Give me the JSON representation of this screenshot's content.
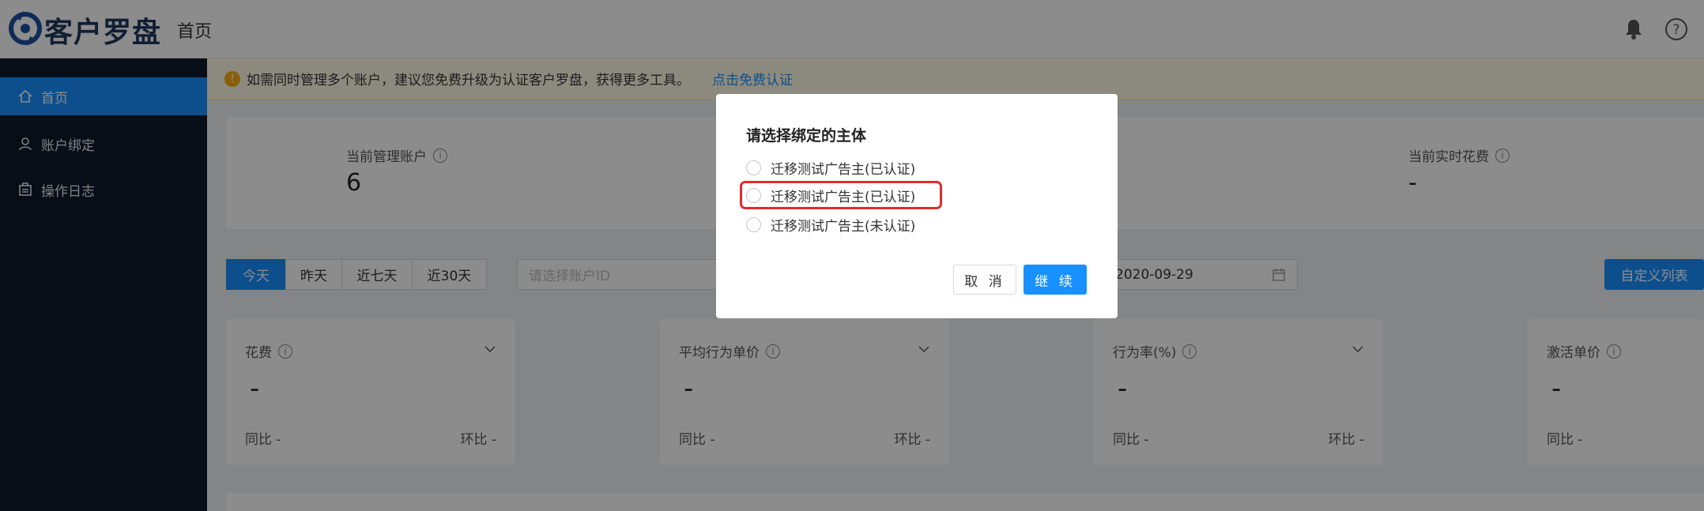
{
  "header": {
    "brand": "客户罗盘",
    "nav_title": "首页",
    "icons": [
      "compass-logo-icon",
      "bell-icon",
      "help-icon"
    ]
  },
  "sidebar": {
    "items": [
      {
        "label": "首页",
        "icon": "home-icon",
        "active": true
      },
      {
        "label": "账户绑定",
        "icon": "user-icon",
        "active": false
      },
      {
        "label": "操作日志",
        "icon": "log-icon",
        "active": false
      }
    ]
  },
  "notice": {
    "text": "如需同时管理多个账户，建议您免费升级为认证客户罗盘，获得更多工具。",
    "link": "点击免费认证"
  },
  "stats": {
    "managed_accounts_label": "当前管理账户",
    "managed_accounts_value": "6",
    "realtime_spend_label": "当前实时花费",
    "realtime_spend_value": "-"
  },
  "filters": {
    "periods": [
      "今天",
      "昨天",
      "近七天",
      "近30天"
    ],
    "active_period": "今天",
    "account_placeholder": "请选择账户ID",
    "date_value": "2020-09-29",
    "custom_columns_label": "自定义列表"
  },
  "metrics": [
    {
      "label": "花费",
      "value": "-",
      "yoy": "同比 -",
      "mom": "环比 -"
    },
    {
      "label": "平均行为单价",
      "value": "-",
      "yoy": "同比 -",
      "mom": "环比 -"
    },
    {
      "label": "行为率(%)",
      "value": "-",
      "yoy": "同比 -",
      "mom": "环比 -"
    },
    {
      "label": "激活单价",
      "value": "-",
      "yoy": "同比 -",
      "mom": ""
    }
  ],
  "modal": {
    "title": "请选择绑定的主体",
    "options": [
      "迁移测试广告主(已认证)",
      "迁移测试广告主(已认证)",
      "迁移测试广告主(未认证)"
    ],
    "highlighted_option_index": 1,
    "cancel_label": "取 消",
    "continue_label": "继 续"
  },
  "colors": {
    "primary": "#1890ff",
    "sidebar_bg": "#0f1b2d",
    "highlight_red": "#e52b2b",
    "notice_bg": "#fffbe6"
  }
}
